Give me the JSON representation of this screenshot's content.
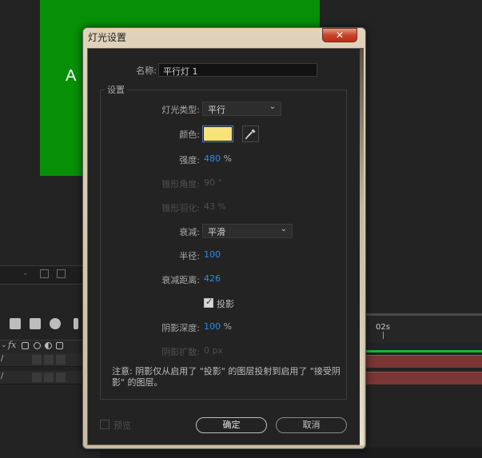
{
  "background": {
    "comp_letter": "A",
    "timeline_time_label": "02s",
    "fx_label": "fx"
  },
  "dialog": {
    "title": "灯光设置",
    "close_glyph": "✕",
    "name_label": "名称:",
    "name_value": "平行灯 1",
    "settings_group_title": "设置",
    "light_type": {
      "label": "灯光类型:",
      "value": "平行"
    },
    "color": {
      "label": "颜色:",
      "value": "#f8e27a"
    },
    "intensity": {
      "label": "强度:",
      "value": "480",
      "unit": "%"
    },
    "cone_angle": {
      "label": "锥形角度:",
      "value": "90",
      "unit": "°"
    },
    "cone_feather": {
      "label": "锥形羽化:",
      "value": "43",
      "unit": "%"
    },
    "falloff": {
      "label": "衰减:",
      "value": "平滑"
    },
    "radius": {
      "label": "半径:",
      "value": "100"
    },
    "falloff_distance": {
      "label": "衰减距离:",
      "value": "426"
    },
    "casts_shadows": {
      "label": "投影",
      "checked": true
    },
    "shadow_darkness": {
      "label": "阴影深度:",
      "value": "100",
      "unit": "%"
    },
    "shadow_diffusion": {
      "label": "阴影扩散:",
      "value": "0 px"
    },
    "note": "注意: 阴影仅从启用了 \"投影\" 的图层投射到启用了 \"接受阴影\" 的图层。",
    "preview": {
      "label": "预览",
      "checked": false
    },
    "ok_label": "确定",
    "cancel_label": "取消"
  },
  "colors": {
    "accent_blue": "#2d8ceb",
    "comp_green": "#079007",
    "timeline_layer_red": "#7a3535",
    "timeline_green": "#20b43a"
  }
}
